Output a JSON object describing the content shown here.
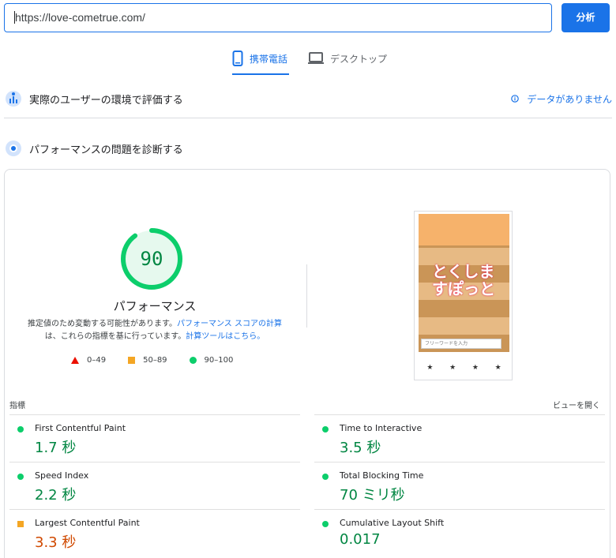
{
  "search": {
    "url": "https://love-cometrue.com/",
    "analyze_label": "分析"
  },
  "tabs": [
    {
      "label": "携帯電話",
      "active": true
    },
    {
      "label": "デスクトップ",
      "active": false
    }
  ],
  "field_data": {
    "title": "実際のユーザーの環境で評価する",
    "no_data": "データがありません"
  },
  "lab_data": {
    "title": "パフォーマンスの問題を診断する"
  },
  "score": {
    "value": "90",
    "fraction": 0.9,
    "label": "パフォーマンス",
    "note_part1": "推定値のため変動する可能性があります。",
    "note_link1": "パフォーマンス スコアの計算",
    "note_part2": "は、これらの指標を基に行っています。",
    "note_link2": "計算ツールはこちら。"
  },
  "legend": {
    "poor": "0–49",
    "average": "50–89",
    "good": "90–100"
  },
  "screenshot": {
    "logo_line1": "とくしま",
    "logo_line2": "すぽっと",
    "search_placeholder": "フリーワードを入力"
  },
  "metrics": {
    "header": "指標",
    "expand": "ビューを開く",
    "left": [
      {
        "name": "First Contentful Paint",
        "value": "1.7 秒",
        "rating": "good"
      },
      {
        "name": "Speed Index",
        "value": "2.2 秒",
        "rating": "good"
      },
      {
        "name": "Largest Contentful Paint",
        "value": "3.3 秒",
        "rating": "average"
      }
    ],
    "right": [
      {
        "name": "Time to Interactive",
        "value": "3.5 秒",
        "rating": "good"
      },
      {
        "name": "Total Blocking Time",
        "value": "70 ミリ秒",
        "rating": "good"
      },
      {
        "name": "Cumulative Layout Shift",
        "value": "0.017",
        "rating": "good"
      }
    ]
  },
  "colors": {
    "accent": "#1a73e8",
    "good": "#0cce6b",
    "good_text": "#018642",
    "average": "#f4a624",
    "average_text": "#d04900",
    "poor": "#eb0f00"
  }
}
